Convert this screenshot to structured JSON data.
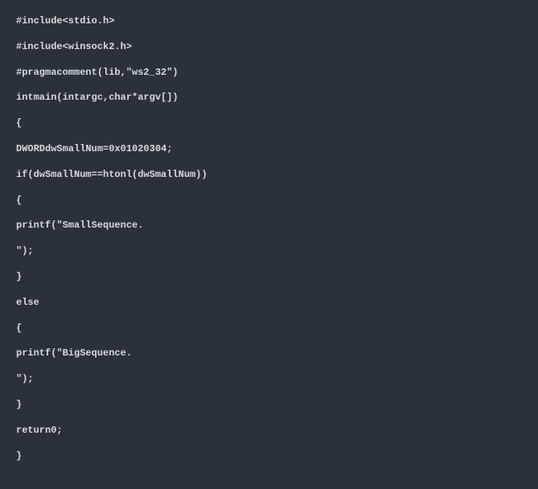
{
  "code": {
    "lines": [
      "#include<stdio.h>",
      "#include<winsock2.h>",
      "#pragmacomment(lib,\"ws2_32\")",
      "intmain(intargc,char*argv[])",
      "{",
      "DWORDdwSmallNum=0x01020304;",
      "if(dwSmallNum==htonl(dwSmallNum))",
      "{",
      "printf(\"SmallSequence.",
      "\");",
      "}",
      "else",
      "{",
      "printf(\"BigSequence.",
      "\");",
      "}",
      "return0;",
      "}"
    ]
  }
}
